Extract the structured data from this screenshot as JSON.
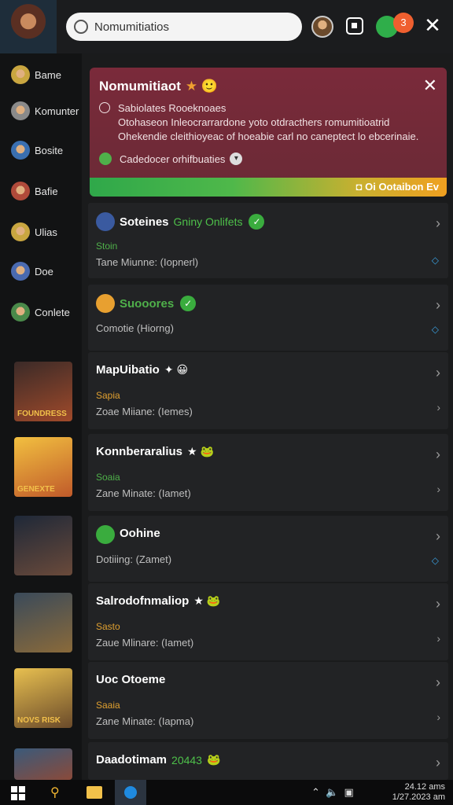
{
  "search": {
    "placeholder": "Nomumitiatios"
  },
  "topbar": {
    "notif_count": "3",
    "close_glyph": "✕"
  },
  "sidebar": {
    "items": [
      {
        "label": "Bame",
        "icon": "star-icon",
        "color": "#c9a640"
      },
      {
        "label": "Komunter",
        "icon": "person-icon",
        "color": "#8a8a8a"
      },
      {
        "label": "Bosite",
        "icon": "hero-icon",
        "color": "#3a6fb0"
      },
      {
        "label": "Bafie",
        "icon": "hero-icon",
        "color": "#b04a3a"
      },
      {
        "label": "Ulias",
        "icon": "hero-icon",
        "color": "#c9a640"
      },
      {
        "label": "Doe",
        "icon": "hero-icon",
        "color": "#4a6ab0"
      },
      {
        "label": "Conlete",
        "icon": "hero-icon",
        "color": "#4a8a4a"
      }
    ],
    "thumbnails": [
      {
        "label": "FOUNDRESS",
        "colors": [
          "#3a2a28",
          "#a04a2a"
        ]
      },
      {
        "label": "GENEXTE",
        "colors": [
          "#f2c040",
          "#c05a2a"
        ]
      },
      {
        "label": "",
        "colors": [
          "#1e2838",
          "#6a4a3a"
        ]
      },
      {
        "label": "",
        "colors": [
          "#3a4a5a",
          "#8a6a3a"
        ]
      },
      {
        "label": "NOVS RISK",
        "colors": [
          "#e8c050",
          "#6a4a2a"
        ]
      },
      {
        "label": "",
        "colors": [
          "#3a5a7a",
          "#8a4a3a"
        ]
      }
    ]
  },
  "notification": {
    "title": "Nomumitiaot",
    "title_emoji": "★ 🙂",
    "line1": "Sabiolates Rooeknoaes",
    "line2": "Otohaseon Inleocrarrardone yoto otdracthers romumitioatrid",
    "line3": "Ohekendie cleithioyeac of hoeabie carl no caneptect lo ebcerinaie.",
    "status": "Cadedocer orhifbuaties",
    "progress_label": "◘ Oi Ootaibon Ev",
    "progress": 1.0
  },
  "cards": [
    {
      "title": "Soteines",
      "status": "Gniny Onlifets",
      "sub1": "Stoin",
      "sub1_color": "#4fb04a",
      "sub2": "Tane Miunne: (Iopnerl)",
      "icon_color": "#3a5aa0",
      "has_icon": true,
      "badge": "✓",
      "sub_icon": "diamond"
    },
    {
      "title": "Suooores",
      "status": "",
      "sub1": "",
      "sub1_color": "#4fb04a",
      "sub2": "Comotie (Hiorng)",
      "icon_color": "#e8a030",
      "has_icon": true,
      "badge": "✓",
      "sub_icon": "diamond",
      "title_color": "#4fb04a"
    },
    {
      "title": "MapUibatio",
      "status": "",
      "sub1": "Sapia",
      "sub1_color": "#e0a030",
      "sub2": "Zoae Miiane: (Iemes)",
      "has_icon": false,
      "emoji": "✦ 😀",
      "sub_icon": "chevron"
    },
    {
      "title": "Konnberaralius",
      "status": "",
      "sub1": "Soaia",
      "sub1_color": "#4fb04a",
      "sub2": "Zane Minate: (Iamet)",
      "has_icon": false,
      "emoji": "★ 🐸",
      "sub_icon": "chevron"
    },
    {
      "title": "Oohine",
      "status": "",
      "sub1": "",
      "sub1_color": "#4fb04a",
      "sub2": "Dotiiing: (Zamet)",
      "has_icon": true,
      "icon_color": "#3aac3e",
      "sub_icon": "diamond"
    },
    {
      "title": "Salrodofnmaliop",
      "status": "",
      "sub1": "Sasto",
      "sub1_color": "#e0a030",
      "sub2": "Zaue Mlinare: (Iamet)",
      "has_icon": false,
      "emoji": "★ 🐸",
      "sub_icon": "chevron"
    },
    {
      "title": "Uoc Otoeme",
      "status": "",
      "sub1": "Saaia",
      "sub1_color": "#e0a030",
      "sub2": "Zane Minate: (Iapma)",
      "has_icon": false,
      "emoji": "",
      "sub_icon": "chevron"
    },
    {
      "title": "Daadotimam",
      "status": "20443",
      "sub1": "",
      "sub1_color": "#4fb04a",
      "sub2": "",
      "has_icon": false,
      "emoji": "🐸",
      "sub_icon": ""
    }
  ],
  "taskbar": {
    "time": "24.12 ams",
    "date": "1/27.2023 am"
  },
  "colors": {
    "accent_green": "#3aac3e",
    "notif_bg": "#7a2a3a",
    "bg": "#141516"
  }
}
